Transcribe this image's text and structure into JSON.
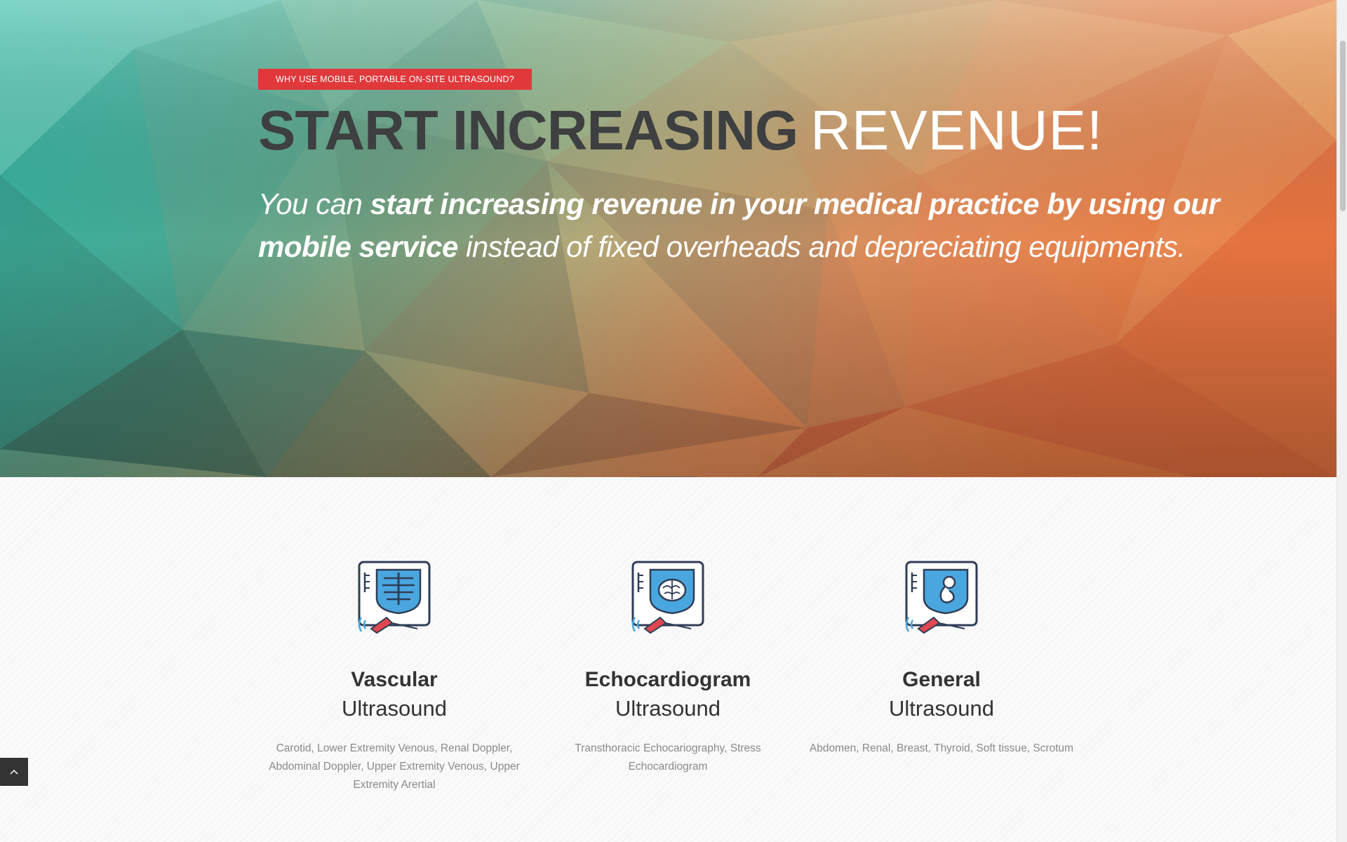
{
  "hero": {
    "badge": "WHY USE MOBILE, PORTABLE ON-SITE ULTRASOUND?",
    "headline_strong": "START INCREASING",
    "headline_light": "REVENUE!",
    "lead_pre": "You can ",
    "lead_bold": "start increasing revenue in your medical practice by using our mobile service",
    "lead_post": " instead of fixed overheads and depreciating equipments."
  },
  "services": [
    {
      "icon": "ultrasound-ribcage-icon",
      "title": "Vascular",
      "subtitle": "Ultrasound",
      "description": "Carotid, Lower Extremity Venous, Renal Doppler, Abdominal Doppler, Upper Extremity Venous, Upper Extremity Arertial"
    },
    {
      "icon": "ultrasound-brain-icon",
      "title": "Echocardiogram",
      "subtitle": "Ultrasound",
      "description": "Transthoracic Echocariography, Stress Echocardiogram"
    },
    {
      "icon": "ultrasound-fetus-icon",
      "title": "General",
      "subtitle": "Ultrasound",
      "description": "Abdomen, Renal, Breast, Thyroid, Soft tissue, Scrotum"
    }
  ],
  "colors": {
    "badge": "#e0383b",
    "headline_dark": "#3d3f40",
    "icon_blue": "#4aa6de",
    "icon_outline": "#2f3d56",
    "probe_red": "#e0474f",
    "back_to_top": "#333333"
  },
  "back_to_top_icon": "chevron-up-icon"
}
